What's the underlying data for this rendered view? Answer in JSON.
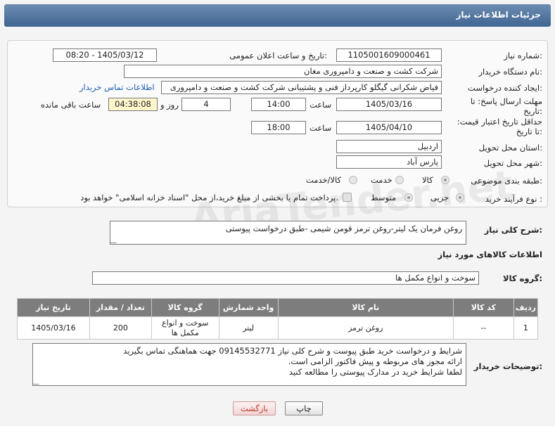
{
  "header": {
    "title": "جزئیات اطلاعات نیاز"
  },
  "form": {
    "need_number": {
      "label": "شماره نیاز:",
      "value": "1105001609000461"
    },
    "announce_datetime": {
      "label": "تاریخ و ساعت اعلان عمومی:",
      "value": "1405/03/12 - 08:20"
    },
    "buyer_org": {
      "label": "نام دستگاه خریدار:",
      "value": "شرکت کشت و صنعت و دامپروری مغان"
    },
    "requester": {
      "label": "ایجاد کننده درخواست:",
      "value": "فیاض شکرانی گیگلو کارپرداز فنی و پشتیبانی شرکت کشت و صنعت و دامپروری",
      "contact_link": "اطلاعات تماس خریدار"
    },
    "reply_deadline": {
      "label": "مهلت ارسال پاسخ: تا تاریخ:",
      "date": "1405/03/16",
      "time_label": "ساعت",
      "time": "14:00",
      "days": "4",
      "days_label": "روز و",
      "remaining": "04:38:08",
      "remaining_label": "ساعت باقی مانده"
    },
    "price_validity": {
      "label": "حداقل تاریخ اعتبار قیمت: تا تاریخ:",
      "date": "1405/04/10",
      "time_label": "ساعت",
      "time": "18:00"
    },
    "province": {
      "label": "استان محل تحویل:",
      "value": "اردبیل"
    },
    "city": {
      "label": "شهر محل تحویل:",
      "value": "پارس آباد"
    },
    "category": {
      "label": "طبقه بندی موضوعی:",
      "options": [
        "کالا",
        "خدمت",
        "کالا/خدمت"
      ],
      "selected": "کالا"
    },
    "purchase_process": {
      "label": "نوع فرآیند خرید :",
      "options": [
        "جزیی",
        "متوسط"
      ],
      "payment_note": "پرداخت تمام یا بخشی از مبلغ خرید،از محل \"اسناد خزانه اسلامی\" خواهد بود."
    }
  },
  "summary": {
    "label": "شرح کلی نیاز:",
    "value": "روغن فرمان یک لیتر-روغن ترمز قومن شیمی -طبق درخواست پیوستی"
  },
  "goods_section": {
    "title": "اطلاعات کالاهای مورد نیاز",
    "group_label": "گروه کالا:",
    "group_value": "سوخت و انواع مکمل ها",
    "table": {
      "headers": [
        "ردیف",
        "کد کالا",
        "نام کالا",
        "واحد شمارش",
        "گروه کالا",
        "تعداد / مقدار",
        "تاریخ نیاز"
      ],
      "rows": [
        [
          "1",
          "--",
          "روغن ترمز",
          "لیتر",
          "سوخت و انواع مکمل ها",
          "200",
          "1405/03/16"
        ]
      ]
    }
  },
  "buyer_notes": {
    "label": "توضیحات خریدار:",
    "lines": [
      "شرایط و درخواست خرید طبق پیوست و شرح کلی نیاز 09145532771 جهت هماهنگی تماس بگیرید",
      "ارائه مجوز های مربوطه و پیش فاکتور الزامی است.",
      "لطفا شرایط خرید در مدارک پیوستی را مطالعه کنید"
    ]
  },
  "buttons": {
    "print": "چاپ",
    "back": "بازگشت"
  },
  "watermark": "AriaTender.net",
  "colors": {
    "header": "#4f729c",
    "table_header": "#7d7d7d",
    "link": "#1a5fb4",
    "back_button": "#c0392b"
  }
}
